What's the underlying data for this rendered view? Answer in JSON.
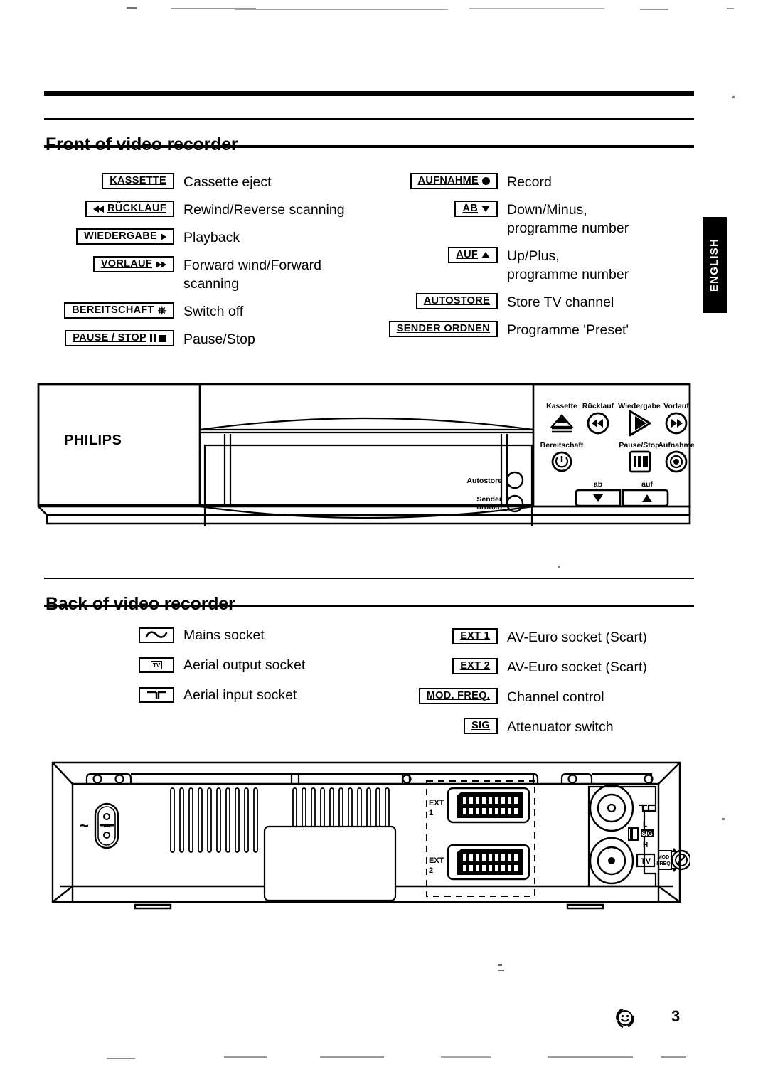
{
  "page": {
    "number": "3",
    "side_tab": "ENGLISH",
    "recycle_icon": "recycle-smiley-icon"
  },
  "front_section": {
    "title": "Front of video recorder",
    "left_items": [
      {
        "key": "KASSETTE",
        "glyphs": [],
        "desc": "Cassette eject"
      },
      {
        "key": "RÜCKLAUF",
        "glyphs": [
          "rewind-left"
        ],
        "desc": "Rewind/Reverse scanning"
      },
      {
        "key": "WIEDERGABE",
        "glyphs": [
          "play-right"
        ],
        "desc": "Playback"
      },
      {
        "key": "VORLAUF",
        "glyphs": [
          "forward-right"
        ],
        "desc": "Forward wind/Forward\nscanning"
      },
      {
        "key": "BEREITSCHAFT",
        "glyphs": [
          "power"
        ],
        "desc": "Switch off"
      },
      {
        "key": "PAUSE / STOP",
        "glyphs": [
          "pause",
          "stop"
        ],
        "desc": "Pause/Stop"
      }
    ],
    "right_items": [
      {
        "key": "AUFNAHME",
        "glyphs": [
          "record-dot"
        ],
        "desc": "Record"
      },
      {
        "key": "AB",
        "glyphs": [
          "triangle-down"
        ],
        "desc": "Down/Minus,\nprogramme number"
      },
      {
        "key": "AUF",
        "glyphs": [
          "triangle-up"
        ],
        "desc": "Up/Plus,\nprogramme number"
      },
      {
        "key": "AUTOSTORE",
        "glyphs": [],
        "desc": "Store TV channel"
      },
      {
        "key": "SENDER ORDNEN",
        "glyphs": [],
        "desc": "Programme 'Preset'"
      }
    ],
    "device": {
      "brand": "PHILIPS",
      "button_labels_top": [
        "Kassette",
        "Rücklauf",
        "Wiedergabe",
        "Vorlauf"
      ],
      "button_labels_bottom": [
        "Bereitschaft",
        "Pause/Stop",
        "Aufnahme"
      ],
      "rocker_labels": [
        "ab",
        "auf"
      ],
      "panel_buttons": [
        "Autostore",
        "Sender\nordnen"
      ]
    }
  },
  "back_section": {
    "title": "Back of video recorder",
    "left_items": [
      {
        "symbol": "mains-socket-icon",
        "desc": "Mains socket"
      },
      {
        "symbol": "aerial-output-tv-icon",
        "desc": "Aerial output socket"
      },
      {
        "symbol": "aerial-input-icon",
        "desc": "Aerial input socket"
      }
    ],
    "right_items": [
      {
        "key": "EXT 1",
        "desc": "AV-Euro socket (Scart)"
      },
      {
        "key": "EXT 2",
        "desc": "AV-Euro socket (Scart)"
      },
      {
        "key": "MOD. FREQ.",
        "desc": "Channel control"
      },
      {
        "key": "SIG",
        "desc": "Attenuator switch"
      }
    ],
    "device": {
      "scart_labels": [
        "EXT\n1",
        "EXT\n2"
      ],
      "mains_symbol": "~",
      "sig_switch": {
        "label": "SIG",
        "positions": [
          "L",
          "H"
        ]
      },
      "tv_out_label": "TV",
      "mod_freq_label": "MOD\nFREQ",
      "aerial_in_label": "Ͳ"
    }
  }
}
